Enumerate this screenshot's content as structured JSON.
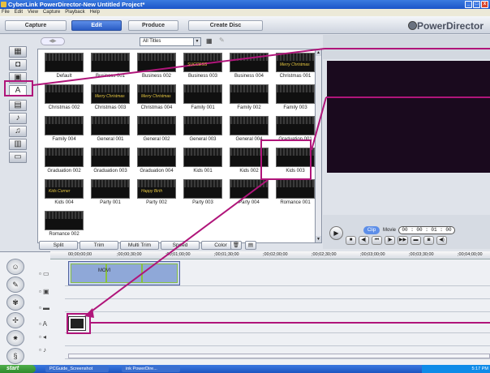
{
  "window": {
    "title": "CyberLink PowerDirector-New Untitled Project*"
  },
  "menu": [
    "File",
    "Edit",
    "View",
    "Capture",
    "Playback",
    "Help"
  ],
  "modes": [
    "Capture",
    "Edit",
    "Produce",
    "Create Disc"
  ],
  "active_mode": "Edit",
  "brand": "PowerDirector",
  "library": {
    "filter": "All Titles",
    "tiles": [
      {
        "label": "Default",
        "thumb": ""
      },
      {
        "label": "Business 001",
        "thumb": ""
      },
      {
        "label": "Business 002",
        "thumb": ""
      },
      {
        "label": "Business 003",
        "thumb": "SUCCESS"
      },
      {
        "label": "Business 004",
        "thumb": ""
      },
      {
        "label": "Christmas 001",
        "thumb": "Merry Christmas"
      },
      {
        "label": "Christmas 002",
        "thumb": ""
      },
      {
        "label": "Christmas 003",
        "thumb": "Merry Christmas"
      },
      {
        "label": "Christmas 004",
        "thumb": "Merry Christmas"
      },
      {
        "label": "Family 001",
        "thumb": ""
      },
      {
        "label": "Family 002",
        "thumb": ""
      },
      {
        "label": "Family 003",
        "thumb": ""
      },
      {
        "label": "Family 004",
        "thumb": ""
      },
      {
        "label": "General 001",
        "thumb": ""
      },
      {
        "label": "General 002",
        "thumb": ""
      },
      {
        "label": "General 003",
        "thumb": ""
      },
      {
        "label": "General 004",
        "thumb": ""
      },
      {
        "label": "Graduation 001",
        "thumb": ""
      },
      {
        "label": "Graduation 002",
        "thumb": ""
      },
      {
        "label": "Graduation 003",
        "thumb": ""
      },
      {
        "label": "Graduation 004",
        "thumb": ""
      },
      {
        "label": "Kids 001",
        "thumb": ""
      },
      {
        "label": "Kids 002",
        "thumb": ""
      },
      {
        "label": "Kids 003",
        "thumb": ""
      },
      {
        "label": "Kids 004",
        "thumb": "Kids Corner"
      },
      {
        "label": "Party 001",
        "thumb": ""
      },
      {
        "label": "Party 002",
        "thumb": "Happy Birth"
      },
      {
        "label": "Party 003",
        "thumb": ""
      },
      {
        "label": "Party 004",
        "thumb": ""
      },
      {
        "label": "Romance 001",
        "thumb": ""
      },
      {
        "label": "Romance 002",
        "thumb": ""
      }
    ],
    "buttons": [
      "Split",
      "Trim",
      "Multi Trim",
      "Speed",
      "Color"
    ]
  },
  "preview": {
    "clip_label": "Clip",
    "movie_label": "Movie",
    "timecode": "00 : 00 : 01 : 00"
  },
  "timeline": {
    "ruler": [
      "00;00;00;00",
      ";00;00;30;00",
      ";00;01;00;00",
      ";00;01;30;00",
      ";00;02;00;00",
      ";00;02;30;00",
      ";00;03;00;00",
      ";00;03;30;00",
      ";00;04;00;00"
    ],
    "video_clip_label": "MOVI"
  },
  "taskbar": {
    "start": "start",
    "tasks": [
      "PCGuide_Screenshot",
      "ink PowerDire..."
    ],
    "clock": "5:17 PM"
  },
  "colors": {
    "accent": "#2a5cc4",
    "annotation": "#b0157a"
  }
}
